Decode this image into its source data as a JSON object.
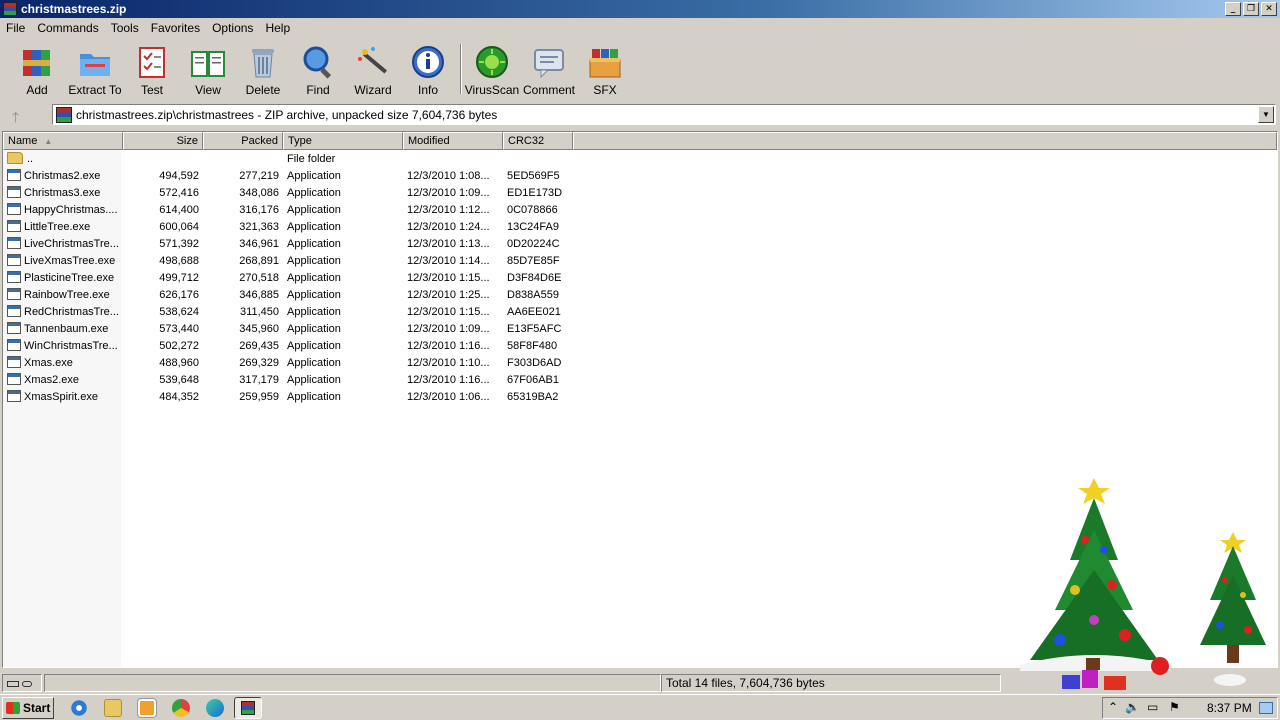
{
  "window": {
    "title": "christmastrees.zip"
  },
  "menu": [
    "File",
    "Commands",
    "Tools",
    "Favorites",
    "Options",
    "Help"
  ],
  "toolbar": [
    {
      "label": "Add",
      "icon": "add-archive-icon"
    },
    {
      "label": "Extract To",
      "icon": "extract-folder-icon"
    },
    {
      "label": "Test",
      "icon": "test-checklist-icon"
    },
    {
      "label": "View",
      "icon": "view-book-icon"
    },
    {
      "label": "Delete",
      "icon": "trash-icon"
    },
    {
      "label": "Find",
      "icon": "magnifier-icon"
    },
    {
      "label": "Wizard",
      "icon": "wand-icon"
    },
    {
      "label": "Info",
      "icon": "info-icon"
    },
    {
      "label": "VirusScan",
      "icon": "virus-scan-icon"
    },
    {
      "label": "Comment",
      "icon": "comment-icon"
    },
    {
      "label": "SFX",
      "icon": "sfx-box-icon"
    }
  ],
  "address": {
    "path": "christmastrees.zip\\christmastrees - ZIP archive, unpacked size 7,604,736 bytes"
  },
  "columns": [
    "Name",
    "Size",
    "Packed",
    "Type",
    "Modified",
    "CRC32"
  ],
  "files": [
    {
      "name": "..",
      "size": "",
      "packed": "",
      "type": "File folder",
      "modified": "",
      "crc": ""
    },
    {
      "name": "Christmas2.exe",
      "size": "494,592",
      "packed": "277,219",
      "type": "Application",
      "modified": "12/3/2010 1:08...",
      "crc": "5ED569F5"
    },
    {
      "name": "Christmas3.exe",
      "size": "572,416",
      "packed": "348,086",
      "type": "Application",
      "modified": "12/3/2010 1:09...",
      "crc": "ED1E173D"
    },
    {
      "name": "HappyChristmas....",
      "size": "614,400",
      "packed": "316,176",
      "type": "Application",
      "modified": "12/3/2010 1:12...",
      "crc": "0C078866"
    },
    {
      "name": "LittleTree.exe",
      "size": "600,064",
      "packed": "321,363",
      "type": "Application",
      "modified": "12/3/2010 1:24...",
      "crc": "13C24FA9"
    },
    {
      "name": "LiveChristmasTre...",
      "size": "571,392",
      "packed": "346,961",
      "type": "Application",
      "modified": "12/3/2010 1:13...",
      "crc": "0D20224C"
    },
    {
      "name": "LiveXmasTree.exe",
      "size": "498,688",
      "packed": "268,891",
      "type": "Application",
      "modified": "12/3/2010 1:14...",
      "crc": "85D7E85F"
    },
    {
      "name": "PlasticineTree.exe",
      "size": "499,712",
      "packed": "270,518",
      "type": "Application",
      "modified": "12/3/2010 1:15...",
      "crc": "D3F84D6E"
    },
    {
      "name": "RainbowTree.exe",
      "size": "626,176",
      "packed": "346,885",
      "type": "Application",
      "modified": "12/3/2010 1:25...",
      "crc": "D838A559"
    },
    {
      "name": "RedChristmasTre...",
      "size": "538,624",
      "packed": "311,450",
      "type": "Application",
      "modified": "12/3/2010 1:15...",
      "crc": "AA6EE021"
    },
    {
      "name": "Tannenbaum.exe",
      "size": "573,440",
      "packed": "345,960",
      "type": "Application",
      "modified": "12/3/2010 1:09...",
      "crc": "E13F5AFC"
    },
    {
      "name": "WinChristmasTre...",
      "size": "502,272",
      "packed": "269,435",
      "type": "Application",
      "modified": "12/3/2010 1:16...",
      "crc": "58F8F480"
    },
    {
      "name": "Xmas.exe",
      "size": "488,960",
      "packed": "269,329",
      "type": "Application",
      "modified": "12/3/2010 1:10...",
      "crc": "F303D6AD"
    },
    {
      "name": "Xmas2.exe",
      "size": "539,648",
      "packed": "317,179",
      "type": "Application",
      "modified": "12/3/2010 1:16...",
      "crc": "67F06AB1"
    },
    {
      "name": "XmasSpirit.exe",
      "size": "484,352",
      "packed": "259,959",
      "type": "Application",
      "modified": "12/3/2010 1:06...",
      "crc": "65319BA2"
    }
  ],
  "status": {
    "summary": "Total 14 files, 7,604,736 bytes"
  },
  "taskbar": {
    "start": "Start",
    "clock": "8:37 PM"
  }
}
